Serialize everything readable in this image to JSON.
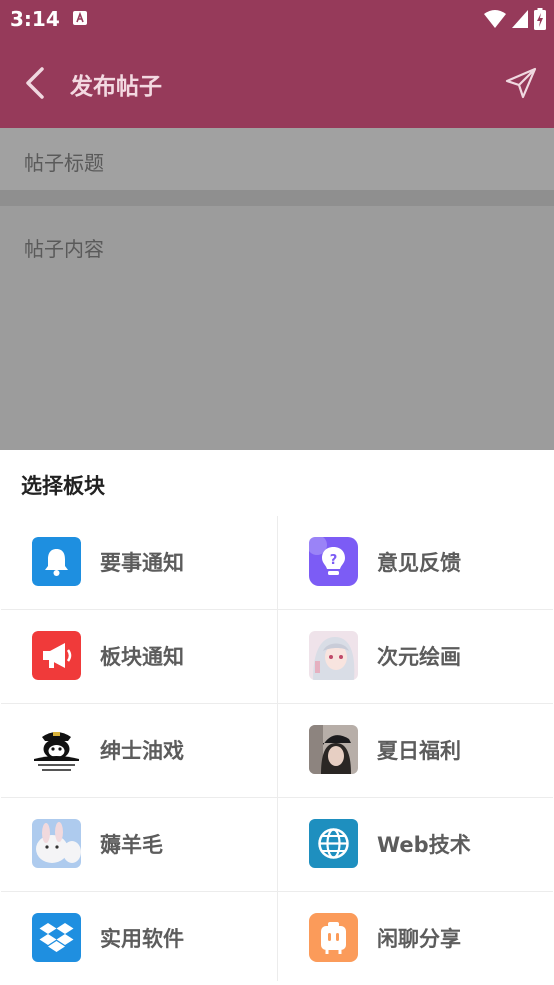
{
  "status": {
    "time": "3:14"
  },
  "appbar": {
    "title": "发布帖子"
  },
  "form": {
    "title_placeholder": "帖子标题",
    "content_placeholder": "帖子内容"
  },
  "sheet": {
    "title": "选择板块",
    "items": [
      {
        "label": "要事通知",
        "icon": "bell-icon",
        "color": "#1e8fe0"
      },
      {
        "label": "意见反馈",
        "icon": "lightbulb-question-icon",
        "color": "#7c5cf5"
      },
      {
        "label": "板块通知",
        "icon": "megaphone-icon",
        "color": "#f03a3a"
      },
      {
        "label": "次元绘画",
        "icon": "anime-girl-avatar",
        "color": "#e7d3de"
      },
      {
        "label": "绅士油戏",
        "icon": "meme-avatar",
        "color": "#ffffff"
      },
      {
        "label": "夏日福利",
        "icon": "girl-photo-avatar",
        "color": "#9a8f8a"
      },
      {
        "label": "薅羊毛",
        "icon": "sheep-avatar",
        "color": "#a9c8ee"
      },
      {
        "label": "Web技术",
        "icon": "globe-icon",
        "color": "#1e8fbf"
      },
      {
        "label": "实用软件",
        "icon": "dropbox-icon",
        "color": "#1f8fe0"
      },
      {
        "label": "闲聊分享",
        "icon": "chat-box-icon",
        "color": "#fb9b5a"
      }
    ]
  }
}
